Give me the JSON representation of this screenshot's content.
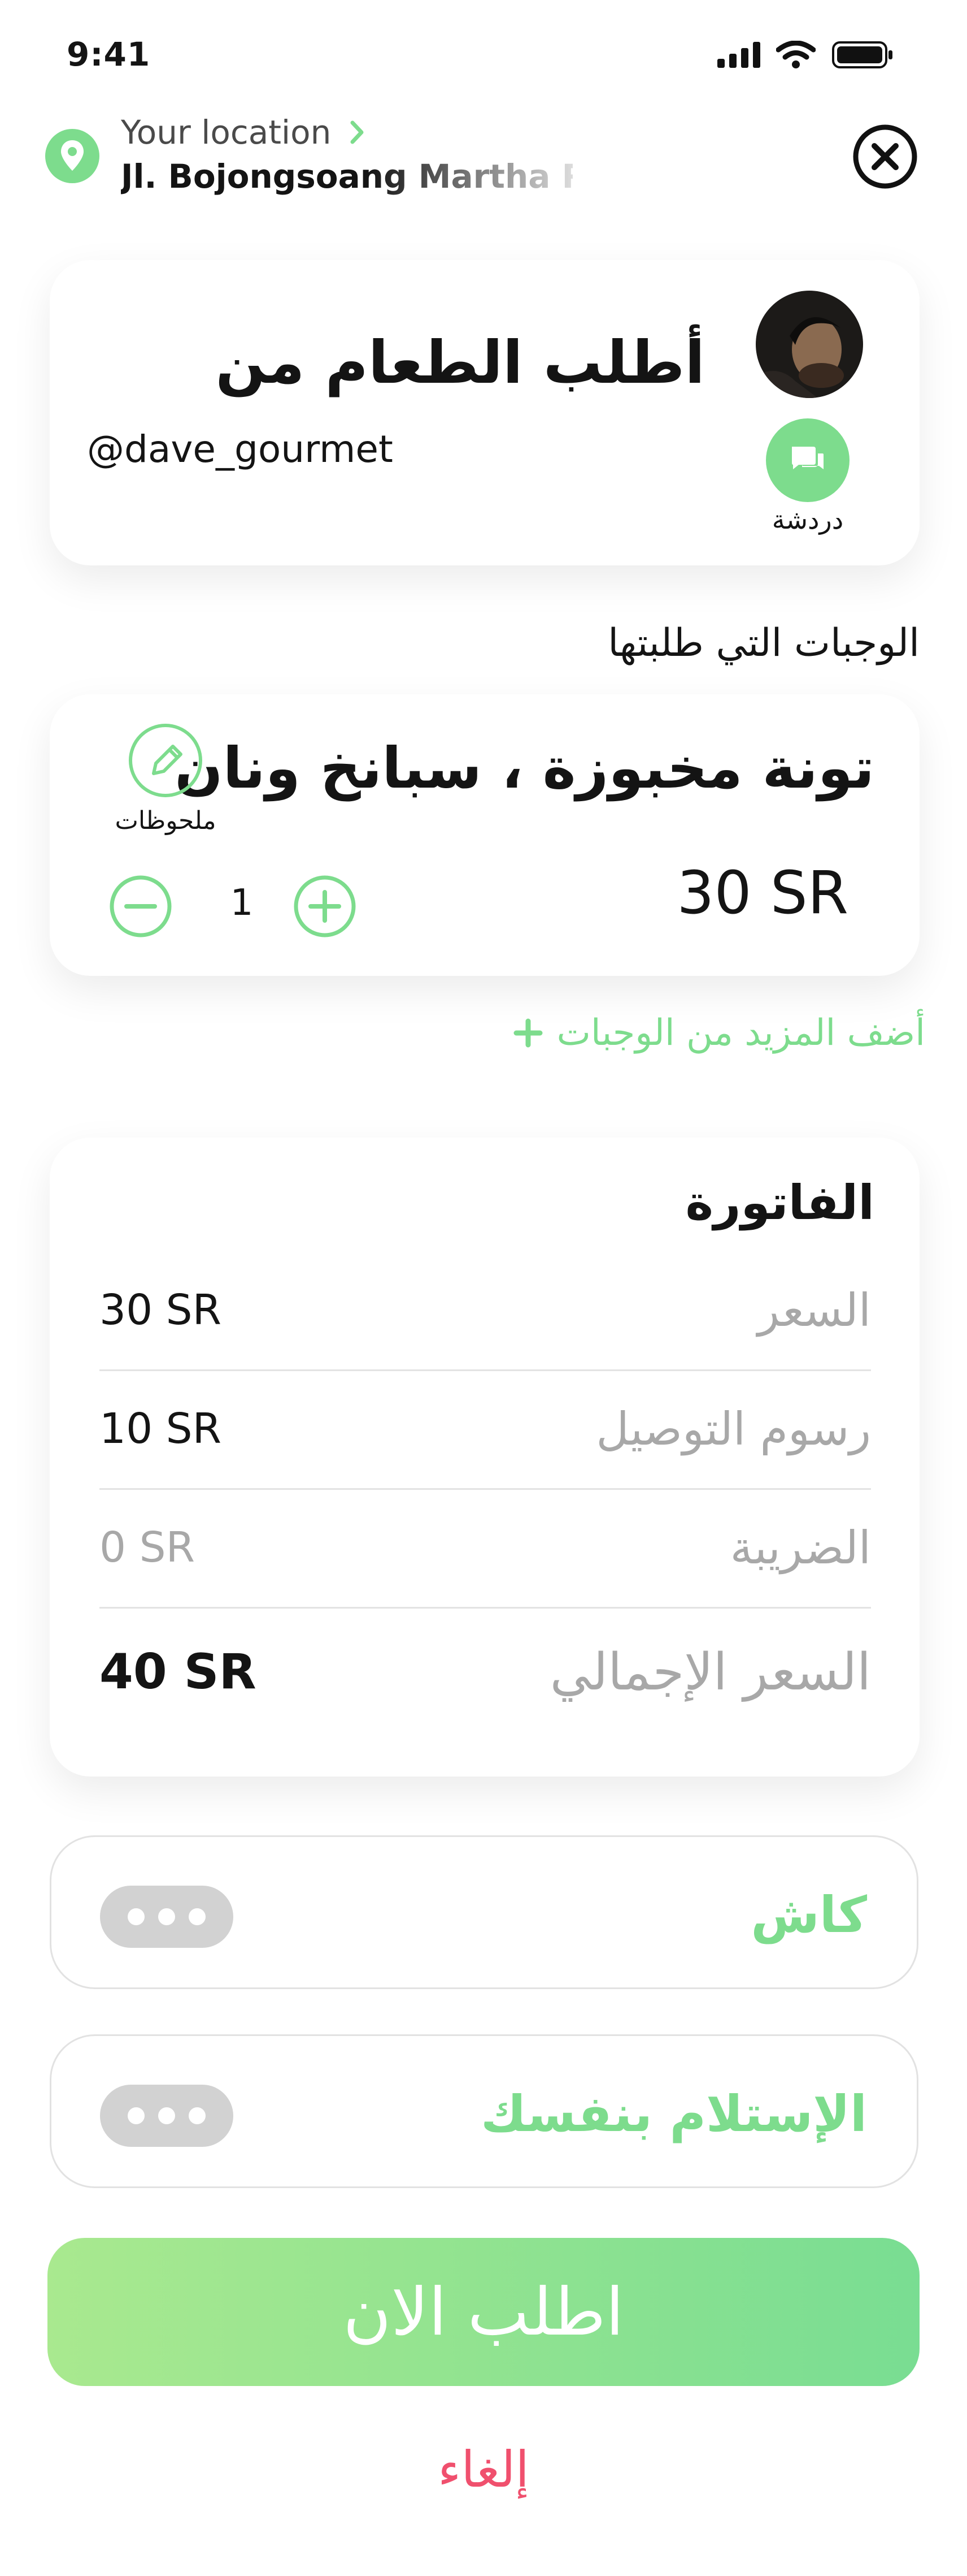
{
  "status_bar": {
    "time": "9:41"
  },
  "location": {
    "label": "Your location",
    "address": "Jl. Bojongsoang Martha Regency"
  },
  "chef": {
    "title": "أطلب الطعام من",
    "handle": "@dave_gourmet",
    "chat_label": "دردشة"
  },
  "meals": {
    "section_title": "الوجبات التي طلبتها",
    "item": {
      "name": "تونة مخبوزة ، سبانخ ونان",
      "price": "30 SR",
      "notes_label": "ملحوظات",
      "quantity": "1"
    },
    "add_more": "أضف المزيد من الوجبات"
  },
  "invoice": {
    "title": "الفاتورة",
    "rows": [
      {
        "label": "السعر",
        "value": "30 SR"
      },
      {
        "label": "رسوم التوصيل",
        "value": "10 SR"
      },
      {
        "label": "الضريبة",
        "value": "0 SR"
      },
      {
        "label": "السعر الإجمالي",
        "value": "40 SR"
      }
    ]
  },
  "options": {
    "payment": "كاش",
    "pickup": "الإستلام بنفسك"
  },
  "actions": {
    "order_now": "اطلب الان",
    "cancel": "إلغاء"
  },
  "colors": {
    "accent": "#7ddc8d",
    "danger": "#f0506e",
    "muted": "#a8a8a8"
  },
  "icons": {
    "location": "map-pin-icon",
    "close": "close-circle-icon",
    "chat": "chat-bubbles-icon",
    "notes": "pencil-icon",
    "minus": "minus-circle-icon",
    "plus": "plus-circle-icon",
    "more": "more-dots-icon"
  }
}
